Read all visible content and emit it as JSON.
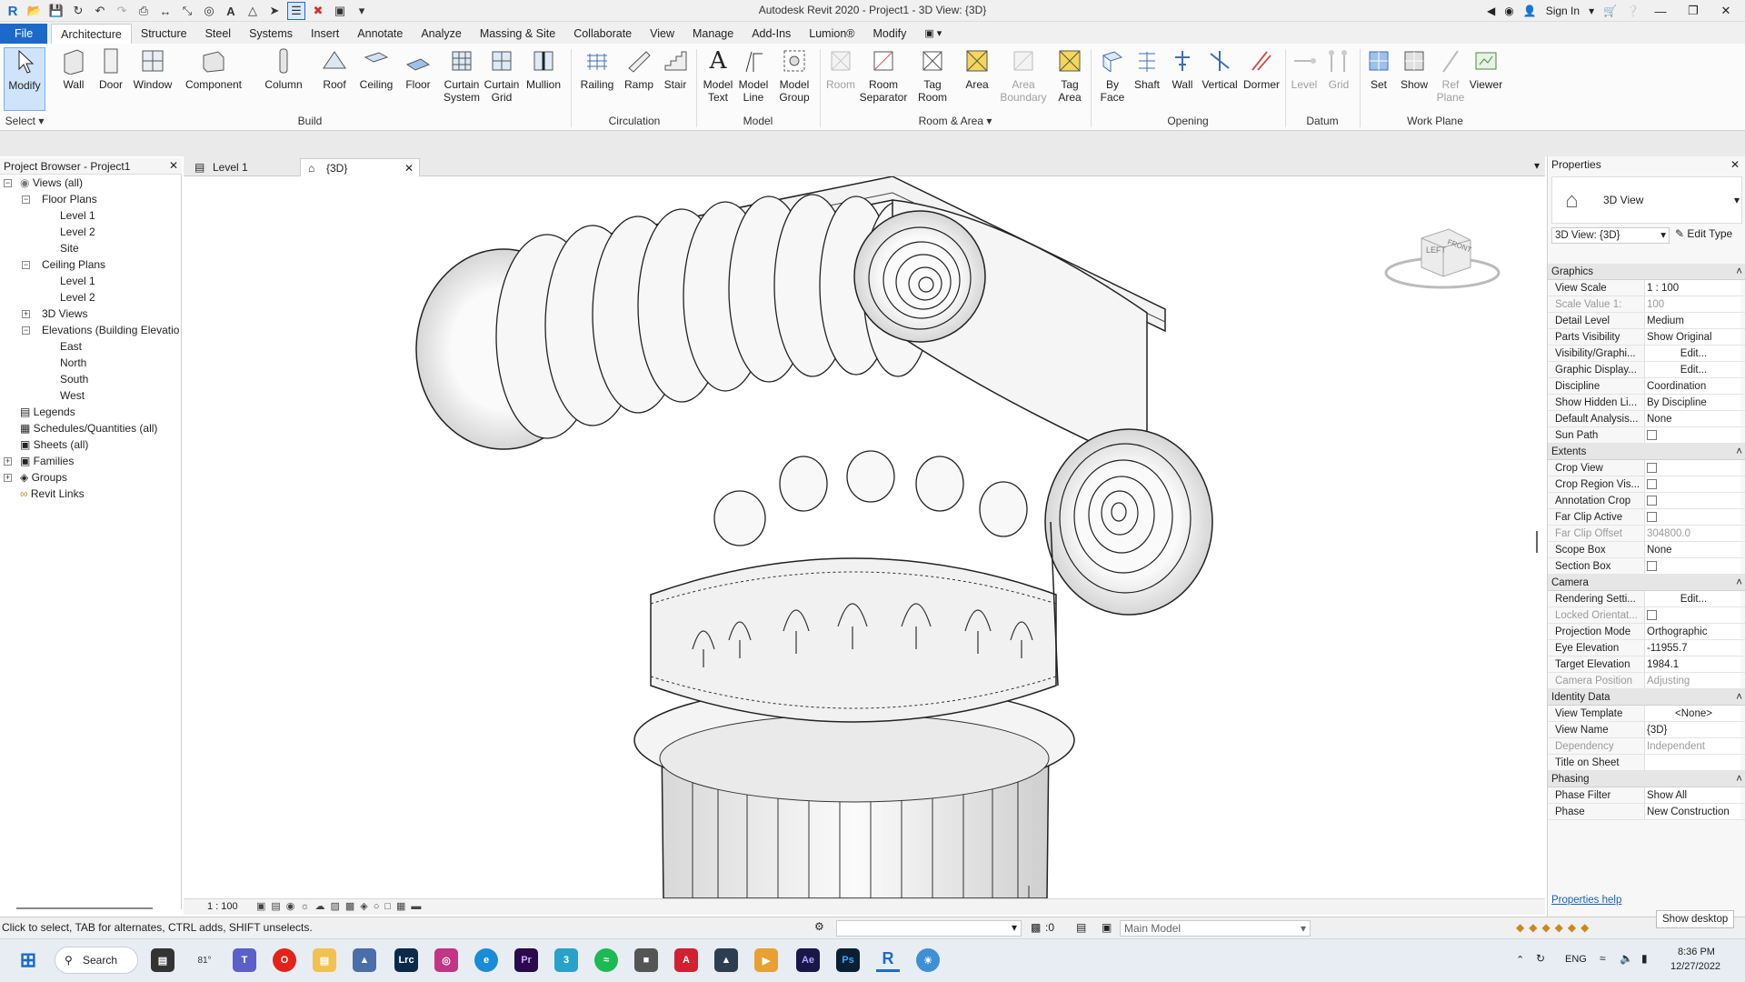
{
  "window": {
    "title": "Autodesk Revit 2020 - Project1 - 3D View: {3D}",
    "sign_in": "Sign In",
    "app_icon": "R"
  },
  "ribbon_tabs": [
    "File",
    "Architecture",
    "Structure",
    "Steel",
    "Systems",
    "Insert",
    "Annotate",
    "Analyze",
    "Massing & Site",
    "Collaborate",
    "View",
    "Manage",
    "Add-Ins",
    "Lumion®",
    "Modify"
  ],
  "active_tab": "Architecture",
  "ribbon": {
    "modify": "Modify",
    "select": "Select",
    "buttons": {
      "wall": "Wall",
      "door": "Door",
      "window": "Window",
      "component": "Component",
      "column": "Column",
      "roof": "Roof",
      "ceiling": "Ceiling",
      "floor": "Floor",
      "curtain_system": [
        "Curtain",
        "System"
      ],
      "curtain_grid": [
        "Curtain",
        "Grid"
      ],
      "mullion": "Mullion",
      "railing": "Railing",
      "ramp": "Ramp",
      "stair": "Stair",
      "model_text": [
        "Model",
        "Text"
      ],
      "model_line": [
        "Model",
        "Line"
      ],
      "model_group": [
        "Model",
        "Group"
      ],
      "room": "Room",
      "room_separator": [
        "Room",
        "Separator"
      ],
      "tag_room": [
        "Tag",
        "Room"
      ],
      "area": "Area",
      "area_boundary": [
        "Area",
        "Boundary"
      ],
      "tag_area": [
        "Tag",
        "Area"
      ],
      "by_face": [
        "By",
        "Face"
      ],
      "shaft": "Shaft",
      "wall_opening": "Wall",
      "vertical": "Vertical",
      "dormer": "Dormer",
      "level": "Level",
      "grid": "Grid",
      "set": "Set",
      "show": "Show",
      "ref_plane": [
        "Ref",
        "Plane"
      ],
      "viewer": "Viewer"
    },
    "groups": {
      "build": "Build",
      "circulation": "Circulation",
      "model": "Model",
      "room_area": "Room & Area",
      "opening": "Opening",
      "datum": "Datum",
      "work_plane": "Work Plane"
    }
  },
  "project_browser": {
    "title": "Project Browser - Project1",
    "items": {
      "views_all": "Views (all)",
      "floor_plans": "Floor Plans",
      "fp_level1": "Level 1",
      "fp_level2": "Level 2",
      "fp_site": "Site",
      "ceiling_plans": "Ceiling Plans",
      "cp_level1": "Level 1",
      "cp_level2": "Level 2",
      "views_3d": "3D Views",
      "elevations": "Elevations (Building Elevation)",
      "east": "East",
      "north": "North",
      "south": "South",
      "west": "West",
      "legends": "Legends",
      "schedules": "Schedules/Quantities (all)",
      "sheets": "Sheets (all)",
      "families": "Families",
      "groups": "Groups",
      "revit_links": "Revit Links"
    }
  },
  "view_tabs": [
    "Level 1",
    "{3D}"
  ],
  "viewcube": {
    "left": "LEFT",
    "front": "FRONT"
  },
  "view_bar": {
    "scale": "1 : 100"
  },
  "properties": {
    "title": "Properties",
    "type": "3D View",
    "selector": "3D View: {3D}",
    "edit_type": "Edit Type",
    "sections": {
      "graphics": "Graphics",
      "extents": "Extents",
      "camera": "Camera",
      "identity": "Identity Data",
      "phasing": "Phasing"
    },
    "graphics": [
      [
        "View Scale",
        "1 : 100"
      ],
      [
        "Scale Value    1:",
        "100"
      ],
      [
        "Detail Level",
        "Medium"
      ],
      [
        "Parts Visibility",
        "Show Original"
      ],
      [
        "Visibility/Graphi...",
        "Edit..."
      ],
      [
        "Graphic Display...",
        "Edit..."
      ],
      [
        "Discipline",
        "Coordination"
      ],
      [
        "Show Hidden Li...",
        "By Discipline"
      ],
      [
        "Default Analysis...",
        "None"
      ],
      [
        "Sun Path",
        ""
      ]
    ],
    "extents": [
      [
        "Crop View",
        ""
      ],
      [
        "Crop Region Vis...",
        ""
      ],
      [
        "Annotation Crop",
        ""
      ],
      [
        "Far Clip Active",
        ""
      ],
      [
        "Far Clip Offset",
        "304800.0"
      ],
      [
        "Scope Box",
        "None"
      ],
      [
        "Section Box",
        ""
      ]
    ],
    "camera": [
      [
        "Rendering Setti...",
        "Edit..."
      ],
      [
        "Locked Orientat...",
        ""
      ],
      [
        "Projection Mode",
        "Orthographic"
      ],
      [
        "Eye Elevation",
        "-11955.7"
      ],
      [
        "Target Elevation",
        "1984.1"
      ],
      [
        "Camera Position",
        "Adjusting"
      ]
    ],
    "identity": [
      [
        "View Template",
        "<None>"
      ],
      [
        "View Name",
        "{3D}"
      ],
      [
        "Dependency",
        "Independent"
      ],
      [
        "Title on Sheet",
        ""
      ]
    ],
    "phasing": [
      [
        "Phase Filter",
        "Show All"
      ],
      [
        "Phase",
        "New Construction"
      ]
    ],
    "help": "Properties help"
  },
  "status": {
    "message": "Click to select, TAB for alternates, CTRL adds, SHIFT unselects.",
    "workset": ":0",
    "model": "Main Model",
    "show_desktop": "Show desktop"
  },
  "taskbar": {
    "search": "Search",
    "weather": "81°",
    "lang": "ENG",
    "time": "8:36 PM",
    "date": "12/27/2022"
  }
}
